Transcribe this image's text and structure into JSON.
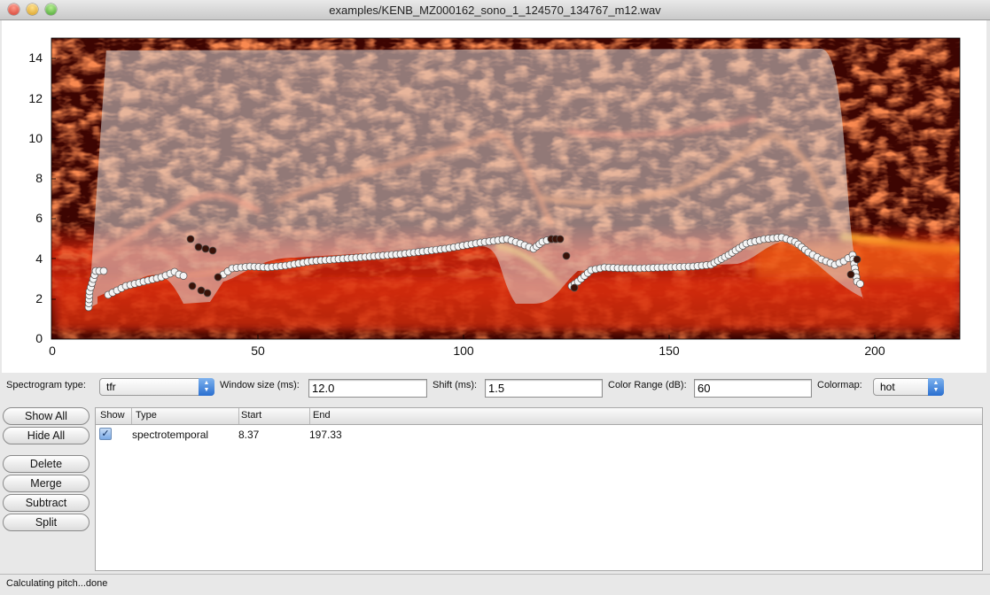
{
  "window": {
    "title": "examples/KENB_MZ000162_sono_1_124570_134767_m12.wav"
  },
  "plot": {
    "x_ticks": [
      "0",
      "50",
      "100",
      "150",
      "200"
    ],
    "y_ticks": [
      "0",
      "2",
      "4",
      "6",
      "8",
      "10",
      "12",
      "14"
    ]
  },
  "controls": {
    "spectrogram_type_label": "Spectrogram type:",
    "spectrogram_type_value": "tfr",
    "window_size_label": "Window size (ms):",
    "window_size_value": "12.0",
    "shift_label": "Shift (ms):",
    "shift_value": "1.5",
    "color_range_label": "Color Range (dB):",
    "color_range_value": "60",
    "colormap_label": "Colormap:",
    "colormap_value": "hot"
  },
  "buttons": {
    "show_all": "Show All",
    "hide_all": "Hide All",
    "delete": "Delete",
    "merge": "Merge",
    "subtract": "Subtract",
    "split": "Split"
  },
  "table": {
    "columns": [
      "Show",
      "Type",
      "Start",
      "End"
    ],
    "rows": [
      {
        "show": true,
        "type": "spectrotemporal",
        "start": "8.37",
        "end": "197.33"
      }
    ]
  },
  "status": "Calculating pitch...done"
}
